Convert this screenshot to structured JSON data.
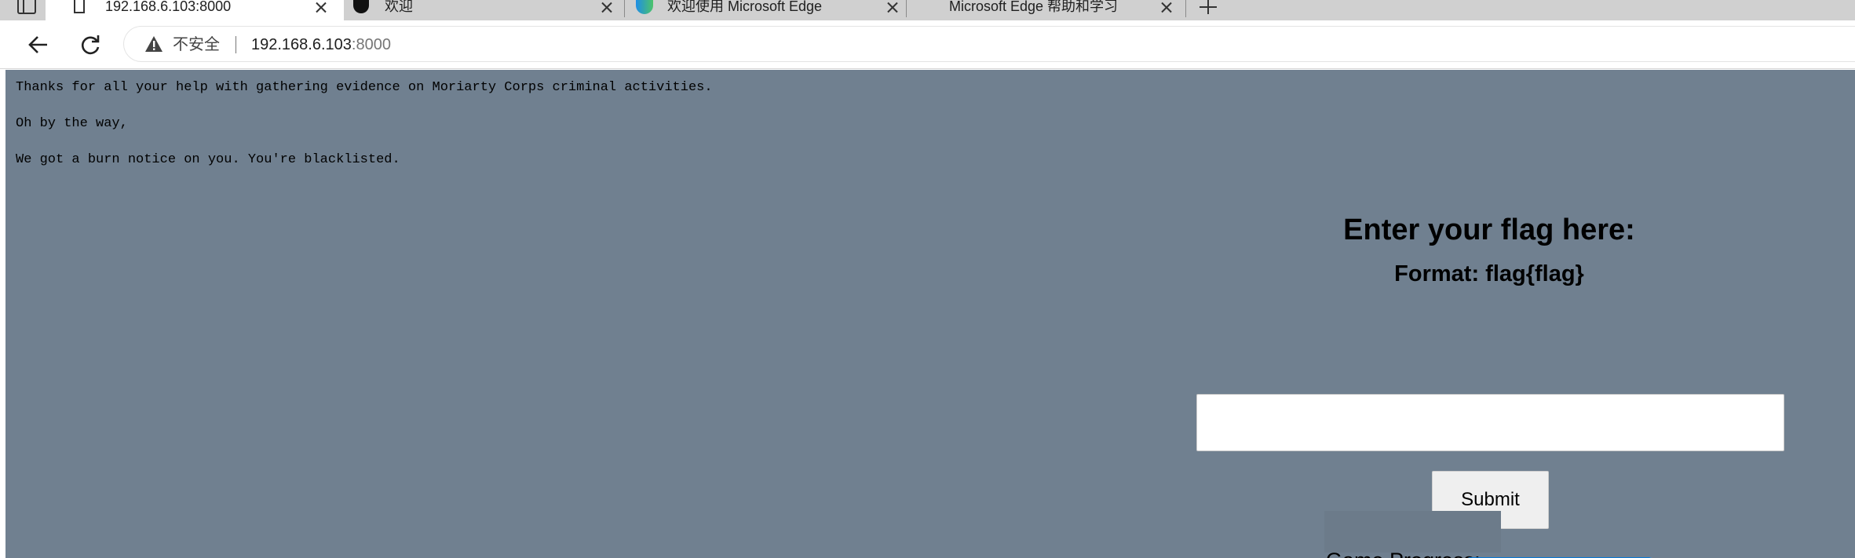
{
  "browser": {
    "tabs": [
      {
        "title": "192.168.6.103:8000",
        "active": true,
        "icon": "page-icon"
      },
      {
        "title": "欢迎",
        "active": false,
        "icon": "edge-dark-icon"
      },
      {
        "title": "欢迎使用 Microsoft Edge",
        "active": false,
        "icon": "edge-icon"
      },
      {
        "title": "Microsoft Edge 帮助和学习",
        "active": false,
        "icon": ""
      }
    ],
    "security_label": "不安全",
    "url_host": "192.168.6.103",
    "url_port": ":8000"
  },
  "page": {
    "lines": [
      "Thanks for all your help with gathering evidence on Moriarty Corps criminal activities.",
      "Oh by the way,",
      "We got a burn notice on you. You're blacklisted."
    ],
    "heading": "Enter your flag here:",
    "format": "Format: flag{flag}",
    "input_value": "",
    "submit_label": "Submit",
    "progress_label": "Game Progress:",
    "progress_fraction": 1.0
  },
  "colors": {
    "page_background": "#708090",
    "progress_fill": "#0a78d4"
  }
}
